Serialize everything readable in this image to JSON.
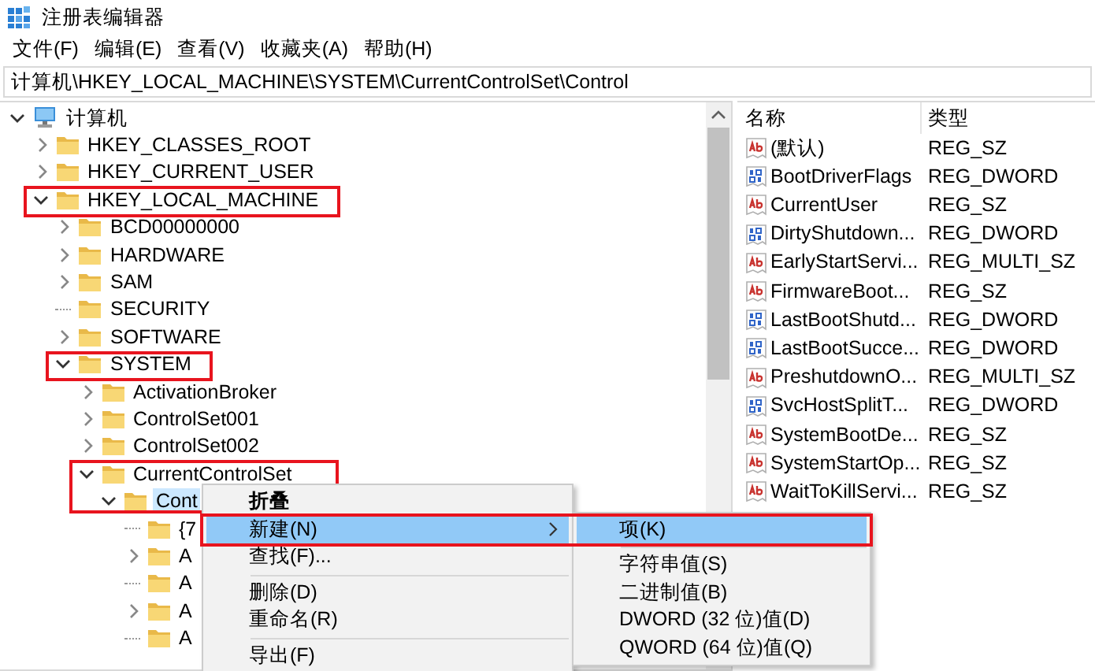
{
  "window": {
    "title": "注册表编辑器"
  },
  "menu_bar": [
    "文件(F)",
    "编辑(E)",
    "查看(V)",
    "收藏夹(A)",
    "帮助(H)"
  ],
  "address_bar": {
    "value": "计算机\\HKEY_LOCAL_MACHINE\\SYSTEM\\CurrentControlSet\\Control"
  },
  "tree": {
    "items": [
      {
        "label": "计算机",
        "kind": "computer",
        "expanded": true,
        "selected": false,
        "children": [
          {
            "label": "HKEY_CLASSES_ROOT",
            "kind": "folder",
            "expanded": false,
            "selected": false
          },
          {
            "label": "HKEY_CURRENT_USER",
            "kind": "folder",
            "expanded": false,
            "selected": false
          },
          {
            "label": "HKEY_LOCAL_MACHINE",
            "kind": "folder",
            "expanded": true,
            "selected": false,
            "outlined": true,
            "children": [
              {
                "label": "BCD00000000",
                "kind": "folder",
                "expanded": false,
                "selected": false
              },
              {
                "label": "HARDWARE",
                "kind": "folder",
                "expanded": false,
                "selected": false
              },
              {
                "label": "SAM",
                "kind": "folder",
                "expanded": false,
                "selected": false
              },
              {
                "label": "SECURITY",
                "kind": "folder",
                "selected": false
              },
              {
                "label": "SOFTWARE",
                "kind": "folder",
                "expanded": false,
                "selected": false
              },
              {
                "label": "SYSTEM",
                "kind": "folder",
                "expanded": true,
                "selected": false,
                "outlined": true,
                "children": [
                  {
                    "label": "ActivationBroker",
                    "kind": "folder",
                    "expanded": false,
                    "selected": false
                  },
                  {
                    "label": "ControlSet001",
                    "kind": "folder",
                    "expanded": false,
                    "selected": false
                  },
                  {
                    "label": "ControlSet002",
                    "kind": "folder",
                    "expanded": false,
                    "selected": false
                  },
                  {
                    "label": "CurrentControlSet",
                    "kind": "folder",
                    "expanded": true,
                    "selected": false,
                    "outlined": true,
                    "children": [
                      {
                        "label": "Cont",
                        "kind": "folder",
                        "expanded": true,
                        "selected": true,
                        "outlined": true,
                        "children": [
                          {
                            "label": "{7",
                            "kind": "folder",
                            "selected": false
                          },
                          {
                            "label": "A",
                            "kind": "folder",
                            "expanded": false,
                            "selected": false
                          },
                          {
                            "label": "A",
                            "kind": "folder",
                            "selected": false
                          },
                          {
                            "label": "A",
                            "kind": "folder",
                            "expanded": false,
                            "selected": false
                          },
                          {
                            "label": "A",
                            "kind": "folder",
                            "selected": false
                          }
                        ]
                      }
                    ]
                  }
                ]
              }
            ]
          }
        ]
      }
    ]
  },
  "values_list": {
    "columns": [
      "名称",
      "类型"
    ],
    "rows": [
      {
        "name": "(默认)",
        "type": "REG_SZ",
        "kind": "string"
      },
      {
        "name": "BootDriverFlags",
        "type": "REG_DWORD",
        "kind": "binary"
      },
      {
        "name": "CurrentUser",
        "type": "REG_SZ",
        "kind": "string"
      },
      {
        "name": "DirtyShutdown...",
        "type": "REG_DWORD",
        "kind": "binary"
      },
      {
        "name": "EarlyStartServi...",
        "type": "REG_MULTI_SZ",
        "kind": "string"
      },
      {
        "name": "FirmwareBoot...",
        "type": "REG_SZ",
        "kind": "string"
      },
      {
        "name": "LastBootShutd...",
        "type": "REG_DWORD",
        "kind": "binary"
      },
      {
        "name": "LastBootSucce...",
        "type": "REG_DWORD",
        "kind": "binary"
      },
      {
        "name": "PreshutdownO...",
        "type": "REG_MULTI_SZ",
        "kind": "string"
      },
      {
        "name": "SvcHostSplitT...",
        "type": "REG_DWORD",
        "kind": "binary"
      },
      {
        "name": "SystemBootDe...",
        "type": "REG_SZ",
        "kind": "string"
      },
      {
        "name": "SystemStartOp...",
        "type": "REG_SZ",
        "kind": "string"
      },
      {
        "name": "WaitToKillServi...",
        "type": "REG_SZ",
        "kind": "string"
      }
    ]
  },
  "context_menu": {
    "items": [
      {
        "kind": "default",
        "label": "折叠",
        "selected": false
      },
      {
        "kind": "submenu",
        "label": "新建(N)",
        "selected": true,
        "outlined": true
      },
      {
        "kind": "item",
        "label": "查找(F)...",
        "selected": false
      },
      {
        "kind": "separator"
      },
      {
        "kind": "item",
        "label": "删除(D)",
        "selected": false
      },
      {
        "kind": "item",
        "label": "重命名(R)",
        "selected": false
      },
      {
        "kind": "separator"
      },
      {
        "kind": "item",
        "label": "导出(F)",
        "selected": false
      }
    ]
  },
  "submenu": {
    "items": [
      {
        "kind": "item",
        "label": "项(K)",
        "selected": true,
        "outlined": true
      },
      {
        "kind": "separator"
      },
      {
        "kind": "item",
        "label": "字符串值(S)",
        "selected": false
      },
      {
        "kind": "item",
        "label": "二进制值(B)",
        "selected": false
      },
      {
        "kind": "item",
        "label": "DWORD (32 位)值(D)",
        "selected": false
      },
      {
        "kind": "item",
        "label": "QWORD (64 位)值(Q)",
        "selected": false
      }
    ]
  }
}
